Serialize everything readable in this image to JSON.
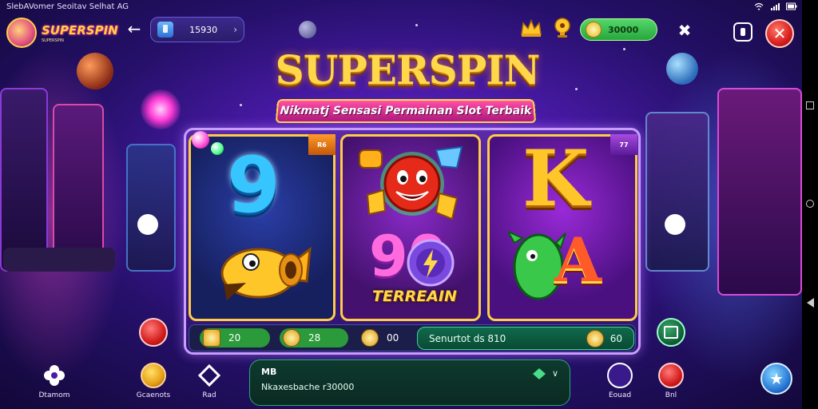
{
  "status_bar": {
    "left_text": "SlebAVomer Seoitav Selhat AG"
  },
  "header": {
    "logo_text": "SUPERSPIN",
    "logo_subtext": "SUPERSPIN",
    "balance_value": "15930",
    "coins_value": "30000"
  },
  "title": {
    "main": "SUPERSPIN",
    "subtitle": "Nikmatj Sensasi Permainan Slot Terbaik"
  },
  "reels": {
    "reel1_symbol_top": "9",
    "reel2_label": "TERREAIN",
    "reel2_symbol_bottom": "90",
    "reel3_symbol_top": "K",
    "reel3_symbol_bottom": "A",
    "reel1_badge": "R6",
    "reel3_badge": "77"
  },
  "bet_bar": {
    "chip1": "20",
    "chip2": "28",
    "chip3": "00",
    "win_label": "Senurtot ds 810",
    "win_value": "60"
  },
  "message": {
    "title": "MB",
    "text": "Nkaxesbache r30000"
  },
  "bottom_nav": [
    {
      "label": "Dtamom",
      "icon": "gear-flower-icon"
    },
    {
      "label": "Gcaenots",
      "icon": "bell-icon"
    },
    {
      "label": "Rad",
      "icon": "diamond-icon"
    },
    {
      "label": "Eouad",
      "icon": "lock-circle-icon"
    },
    {
      "label": "Bnl",
      "icon": "gift-icon"
    }
  ],
  "colors": {
    "gold": "#ffd84a",
    "accent_green": "#27a63c",
    "close_red": "#d81e1e",
    "bg_purple": "#4a1aa8"
  }
}
